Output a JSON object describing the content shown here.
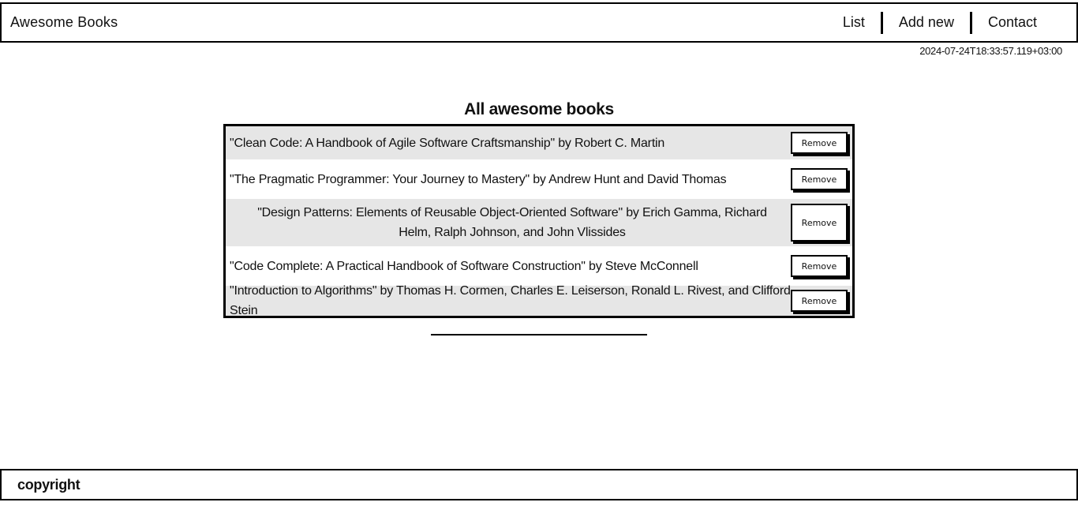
{
  "header": {
    "brand": "Awesome Books",
    "nav": [
      "List",
      "Add new",
      "Contact"
    ]
  },
  "datetime": "2024-07-24T18:33:57.119+03:00",
  "main": {
    "title": "All awesome books",
    "remove_label": "Remove",
    "books": [
      "\"Clean Code: A Handbook of Agile Software Craftsmanship\" by Robert C. Martin",
      "\"The Pragmatic Programmer: Your Journey to Mastery\" by Andrew Hunt and David Thomas",
      "\"Design Patterns: Elements of Reusable Object-Oriented Software\" by Erich Gamma, Richard Helm, Ralph Johnson, and John Vlissides",
      "\"Code Complete: A Practical Handbook of Software Construction\" by Steve McConnell",
      "\"Introduction to Algorithms\" by Thomas H. Cormen, Charles E. Leiserson, Ronald L. Rivest, and Clifford Stein"
    ]
  },
  "footer": {
    "text": "copyright"
  }
}
